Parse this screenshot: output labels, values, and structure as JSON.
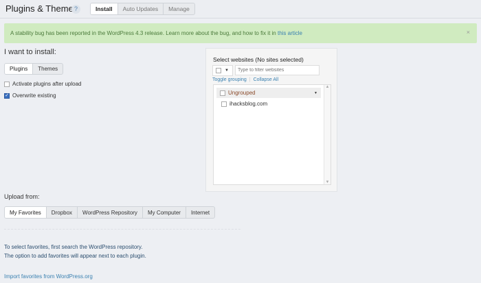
{
  "header": {
    "title": "Plugins & Themes",
    "help": "?",
    "tabs": [
      "Install",
      "Auto Updates",
      "Manage"
    ]
  },
  "notice": {
    "text": "A stability bug has been reported in the WordPress 4.3 release. Learn more about the bug, and how to fix it in ",
    "link": "this article",
    "close": "×"
  },
  "install": {
    "heading": "I want to install:",
    "tabs": [
      "Plugins",
      "Themes"
    ],
    "options": [
      {
        "label": "Activate plugins after upload",
        "checked": false
      },
      {
        "label": "Overwrite existing",
        "checked": true
      }
    ]
  },
  "sites": {
    "title": "Select websites (No sites selected)",
    "filter_placeholder": "Type to filter websites",
    "toggle": "Toggle grouping",
    "collapse": "Collapse All",
    "group": "Ungrouped",
    "items": [
      "ihacksblog.com"
    ]
  },
  "upload": {
    "heading": "Upload from:",
    "tabs": [
      "My Favorites",
      "Dropbox",
      "WordPress Repository",
      "My Computer",
      "Internet"
    ],
    "line1": "To select favorites, first search the WordPress repository.",
    "line2": "The option to add favorites will appear next to each plugin.",
    "import": "Import favorites from WordPress.org"
  }
}
